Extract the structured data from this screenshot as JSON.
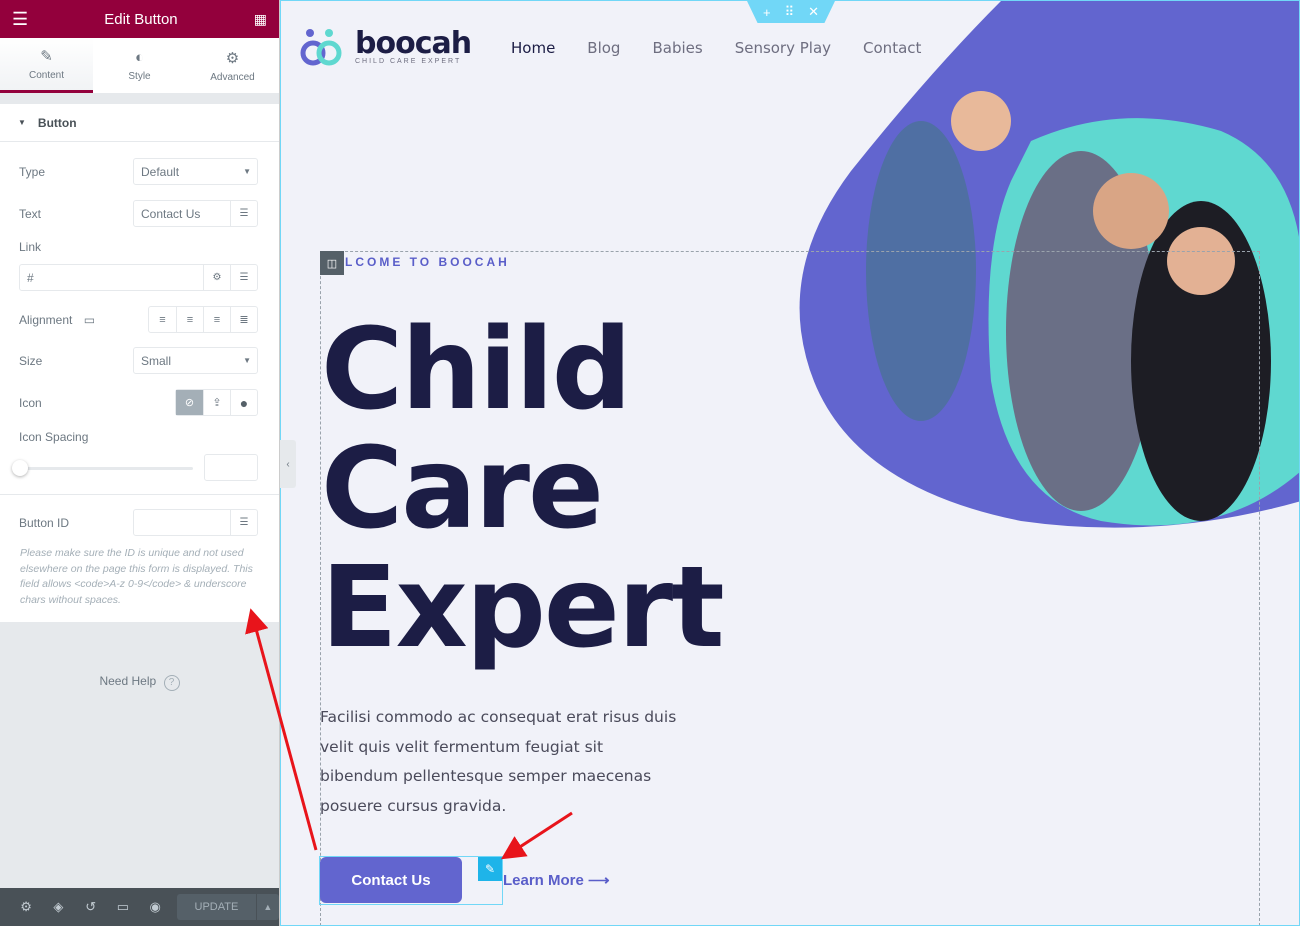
{
  "panel": {
    "title": "Edit Button",
    "tabs": [
      {
        "label": "Content",
        "icon": "pencil-icon"
      },
      {
        "label": "Style",
        "icon": "half-circle-icon"
      },
      {
        "label": "Advanced",
        "icon": "gear-icon"
      }
    ],
    "section": "Button",
    "type": {
      "label": "Type",
      "value": "Default"
    },
    "text": {
      "label": "Text",
      "value": "Contact Us"
    },
    "link": {
      "label": "Link",
      "value": "#"
    },
    "alignment": {
      "label": "Alignment"
    },
    "size": {
      "label": "Size",
      "value": "Small"
    },
    "icon": {
      "label": "Icon"
    },
    "icon_spacing": {
      "label": "Icon Spacing",
      "value": 0
    },
    "button_id": {
      "label": "Button ID",
      "value": ""
    },
    "note": "Please make sure the ID is unique and not used elsewhere on the page this form is displayed. This field allows <code>A-z 0-9</code> & underscore chars without spaces.",
    "help": "Need Help",
    "update": "UPDATE"
  },
  "site": {
    "brand": "boocah",
    "tagline": "CHILD CARE EXPERT",
    "nav": [
      "Home",
      "Blog",
      "Babies",
      "Sensory Play",
      "Contact"
    ],
    "welcome": "LCOME TO BOOCAH",
    "title_lines": [
      "Child",
      "Care",
      "Expert"
    ],
    "paragraph": "Facilisi commodo ac consequat erat risus duis velit quis velit fermentum feugiat sit bibendum pellentesque semper maecenas posuere cursus gravida.",
    "primary_button": "Contact Us",
    "secondary_link": "Learn More",
    "colors": {
      "accent": "#6265cf",
      "teal": "#5fd8d0",
      "dark": "#1c1d45",
      "editor": "#93003c"
    }
  }
}
